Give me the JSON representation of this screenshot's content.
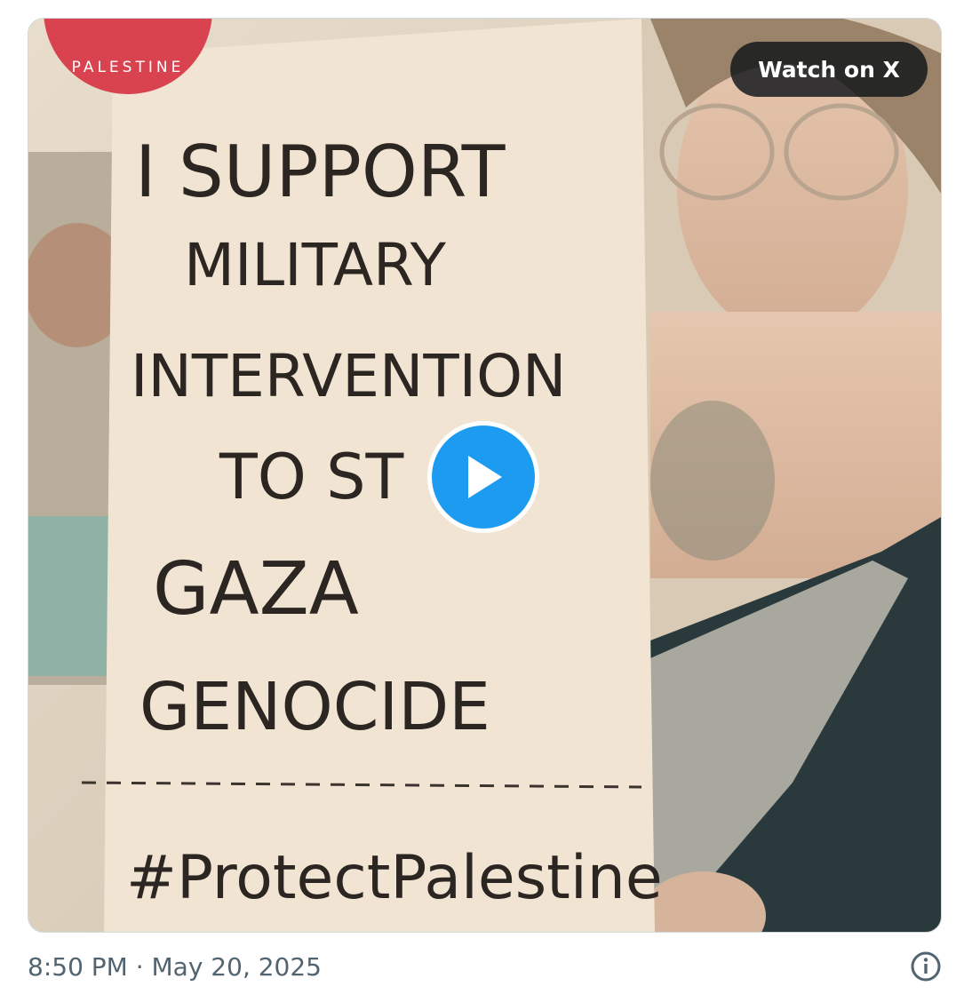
{
  "media": {
    "sign_lines": [
      "I SUPPORT",
      "MILITARY",
      "INTERVENTION",
      "TO ST",
      "GAZA",
      "GENOCIDE"
    ],
    "hashtag": "#ProtectPalestine",
    "badge_text": "PALESTINE"
  },
  "watch_button": {
    "label": "Watch on X"
  },
  "play_button": {
    "icon": "play-icon"
  },
  "footer": {
    "timestamp": "8:50 PM · May 20, 2025",
    "info_icon": "info-icon"
  },
  "colors": {
    "play_accent": "#1d9bf0",
    "timestamp_text": "#536471",
    "badge_red": "#d9434f"
  }
}
